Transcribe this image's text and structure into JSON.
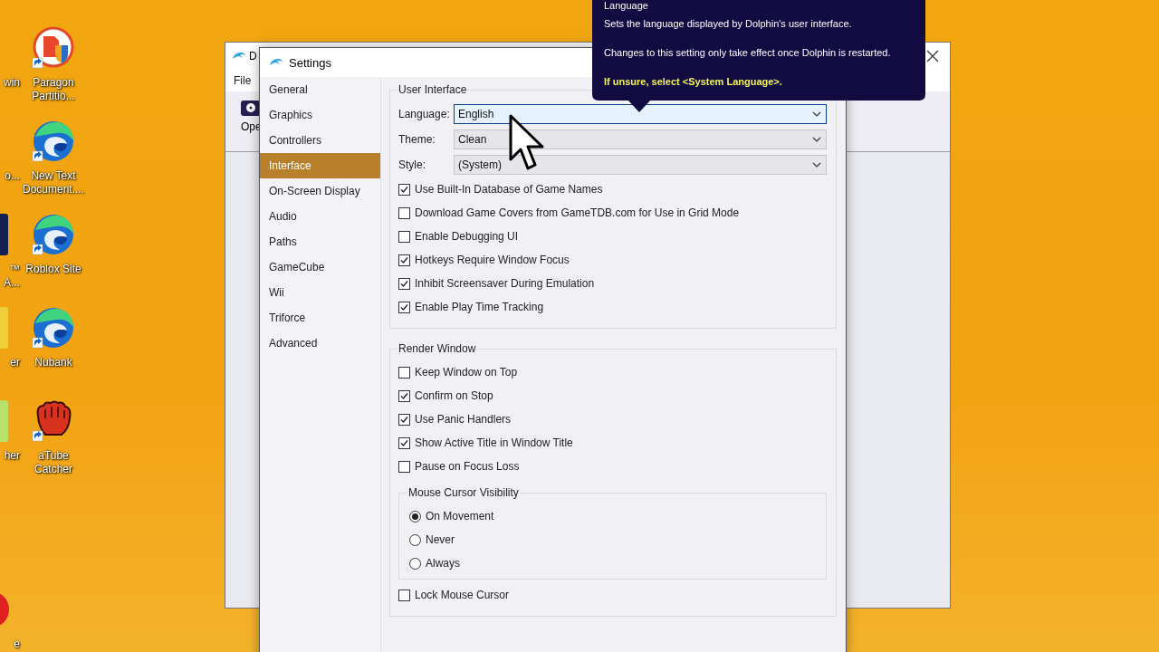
{
  "desktop": {
    "partial_labels": [
      {
        "label": "win",
        "kind": "none"
      },
      {
        "label": "o...",
        "kind": "none"
      },
      {
        "label": "™ A...",
        "kind": "dark"
      },
      {
        "label": "er",
        "kind": "yellow"
      },
      {
        "label": "her",
        "kind": "green"
      },
      {
        "label": "e",
        "kind": "red"
      }
    ],
    "icons": [
      {
        "label": "Paragon Partitio...",
        "kind": "paragon"
      },
      {
        "label": "New Text Document....",
        "kind": "edge"
      },
      {
        "label": "Roblox Site",
        "kind": "edge"
      },
      {
        "label": "Nubank",
        "kind": "edge"
      },
      {
        "label": "aTube Catcher",
        "kind": "glove"
      }
    ]
  },
  "main_window": {
    "title": "D",
    "menu": [
      "File"
    ],
    "toolbar": [
      "Ope"
    ]
  },
  "settings": {
    "title": "Settings",
    "sidebar": [
      {
        "label": "General",
        "selected": false
      },
      {
        "label": "Graphics",
        "selected": false
      },
      {
        "label": "Controllers",
        "selected": false
      },
      {
        "label": "Interface",
        "selected": true
      },
      {
        "label": "On-Screen Display",
        "selected": false
      },
      {
        "label": "Audio",
        "selected": false
      },
      {
        "label": "Paths",
        "selected": false
      },
      {
        "label": "GameCube",
        "selected": false
      },
      {
        "label": "Wii",
        "selected": false
      },
      {
        "label": "Triforce",
        "selected": false
      },
      {
        "label": "Advanced",
        "selected": false
      }
    ],
    "groups": [
      {
        "title": "User Interface",
        "items": [
          {
            "kind": "combo",
            "label": "Language:",
            "value": "English",
            "focused": true
          },
          {
            "kind": "combo",
            "label": "Theme:",
            "value": "Clean",
            "focused": false
          },
          {
            "kind": "combo",
            "label": "Style:",
            "value": "(System)",
            "focused": false
          },
          {
            "kind": "checkbox",
            "label": "Use Built-In Database of Game Names",
            "checked": true
          },
          {
            "kind": "checkbox",
            "label": "Download Game Covers from GameTDB.com for Use in Grid Mode",
            "checked": false
          },
          {
            "kind": "checkbox",
            "label": "Enable Debugging UI",
            "checked": false
          },
          {
            "kind": "checkbox",
            "label": "Hotkeys Require Window Focus",
            "checked": true
          },
          {
            "kind": "checkbox",
            "label": "Inhibit Screensaver During Emulation",
            "checked": true
          },
          {
            "kind": "checkbox",
            "label": "Enable Play Time Tracking",
            "checked": true
          }
        ]
      },
      {
        "title": "Render Window",
        "items": [
          {
            "kind": "checkbox",
            "label": "Keep Window on Top",
            "checked": false
          },
          {
            "kind": "checkbox",
            "label": "Confirm on Stop",
            "checked": true
          },
          {
            "kind": "checkbox",
            "label": "Use Panic Handlers",
            "checked": true
          },
          {
            "kind": "checkbox",
            "label": "Show Active Title in Window Title",
            "checked": true
          },
          {
            "kind": "checkbox",
            "label": "Pause on Focus Loss",
            "checked": false
          },
          {
            "kind": "radio_group",
            "title": "Mouse Cursor Visibility",
            "options": [
              {
                "label": "On Movement",
                "selected": true
              },
              {
                "label": "Never",
                "selected": false
              },
              {
                "label": "Always",
                "selected": false
              }
            ]
          },
          {
            "kind": "checkbox",
            "label": "Lock Mouse Cursor",
            "checked": false
          }
        ]
      }
    ]
  },
  "tooltip": {
    "title": "Language",
    "lines": [
      "Sets the language displayed by Dolphin's user interface.",
      "Changes to this setting only take effect once Dolphin is restarted."
    ],
    "hint": "If unsure, select <System Language>."
  }
}
